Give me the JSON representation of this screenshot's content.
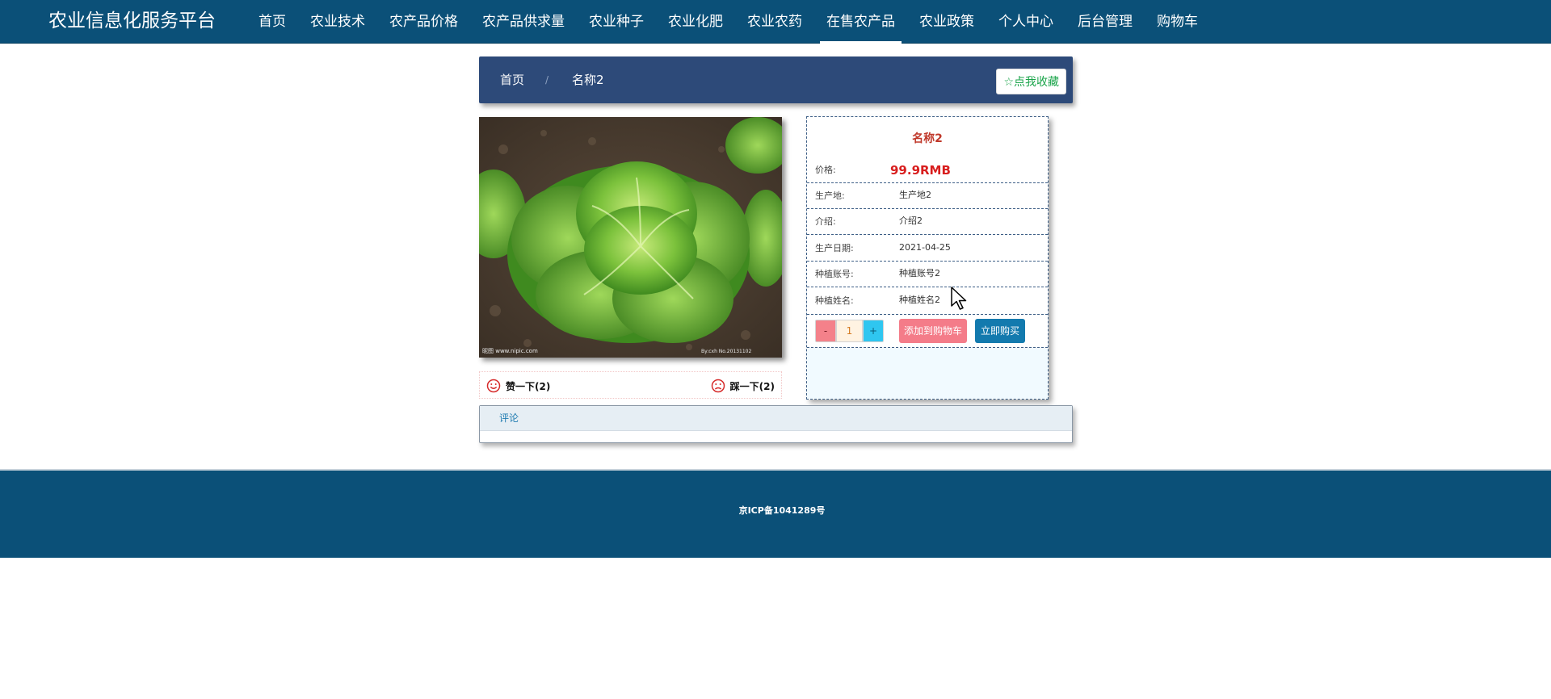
{
  "nav": {
    "brand": "农业信息化服务平台",
    "items": [
      {
        "label": "首页"
      },
      {
        "label": "农业技术"
      },
      {
        "label": "农产品价格"
      },
      {
        "label": "农产品供求量"
      },
      {
        "label": "农业种子"
      },
      {
        "label": "农业化肥"
      },
      {
        "label": "农业农药"
      },
      {
        "label": "在售农产品",
        "active": true
      },
      {
        "label": "农业政策"
      },
      {
        "label": "个人中心"
      },
      {
        "label": "后台管理"
      },
      {
        "label": "购物车"
      }
    ]
  },
  "breadcrumb": {
    "home": "首页",
    "separator": "/",
    "current": "名称2",
    "favorite": "☆点我收藏"
  },
  "product": {
    "image_icon": "lettuce-photo",
    "name": "名称2",
    "price_label": "价格:",
    "price": "99.9RMB",
    "fields": [
      {
        "label": "生产地:",
        "value": "生产地2"
      },
      {
        "label": "介绍:",
        "value": "介绍2"
      },
      {
        "label": "生产日期:",
        "value": "2021-04-25"
      },
      {
        "label": "种植账号:",
        "value": "种植账号2"
      },
      {
        "label": "种植姓名:",
        "value": "种植姓名2"
      }
    ],
    "quantity": {
      "minus": "-",
      "value": "1",
      "plus": "+"
    },
    "add_to_cart": "添加到购物车",
    "buy_now": "立即购买"
  },
  "votes": {
    "like": "赞一下(2)",
    "dislike": "踩一下(2)"
  },
  "comments": {
    "tab": "评论"
  },
  "footer": {
    "icp": "京ICP备1041289号"
  },
  "colors": {
    "nav_bg": "#0b5078",
    "breadcrumb_bg": "#2d4a79",
    "price": "#d81e1e",
    "title": "#c0392b",
    "add_cart_bg": "#f47c89",
    "buy_bg": "#137aae"
  }
}
